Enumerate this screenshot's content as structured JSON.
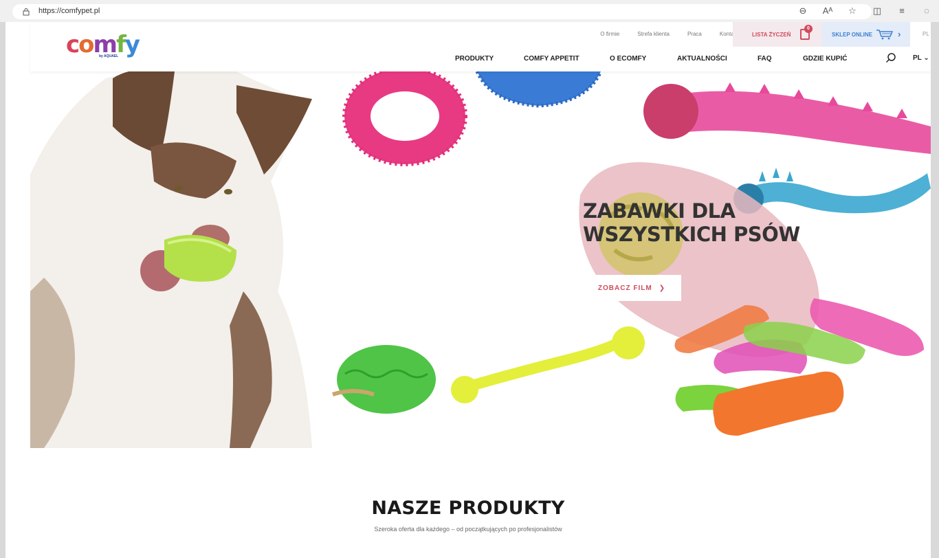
{
  "browser": {
    "url": "https://comfypet.pl"
  },
  "header": {
    "logo": {
      "letters": [
        "c",
        "o",
        "m",
        "f",
        "y"
      ],
      "sub": "by AQUAEL"
    },
    "top_links": [
      "O firmie",
      "Strefa klienta",
      "Praca",
      "Kontakt"
    ],
    "wishlist": {
      "label": "LISTA ŻYCZEŃ",
      "count": "0"
    },
    "shop": {
      "label": "SKLEP ONLINE"
    },
    "lang_top": "PL",
    "main_nav": [
      "PRODUKTY",
      "COMFY APPETIT",
      "O ECOMFY",
      "AKTUALNOŚCI",
      "FAQ",
      "GDZIE KUPIĆ"
    ],
    "lang": "PL"
  },
  "hero": {
    "title_line1": "ZABAWKI DLA",
    "title_line2": "WSZYSTKICH PSÓW",
    "button_label": "ZOBACZ FILM"
  },
  "products": {
    "title": "NASZE PRODUKTY",
    "subtitle": "Szeroka oferta dla każdego – od początkujących po profesjonalistów"
  },
  "colors": {
    "accent_red": "#d14a5d",
    "accent_blue": "#3f7fd0",
    "blob_pink": "#e8b8bf"
  }
}
